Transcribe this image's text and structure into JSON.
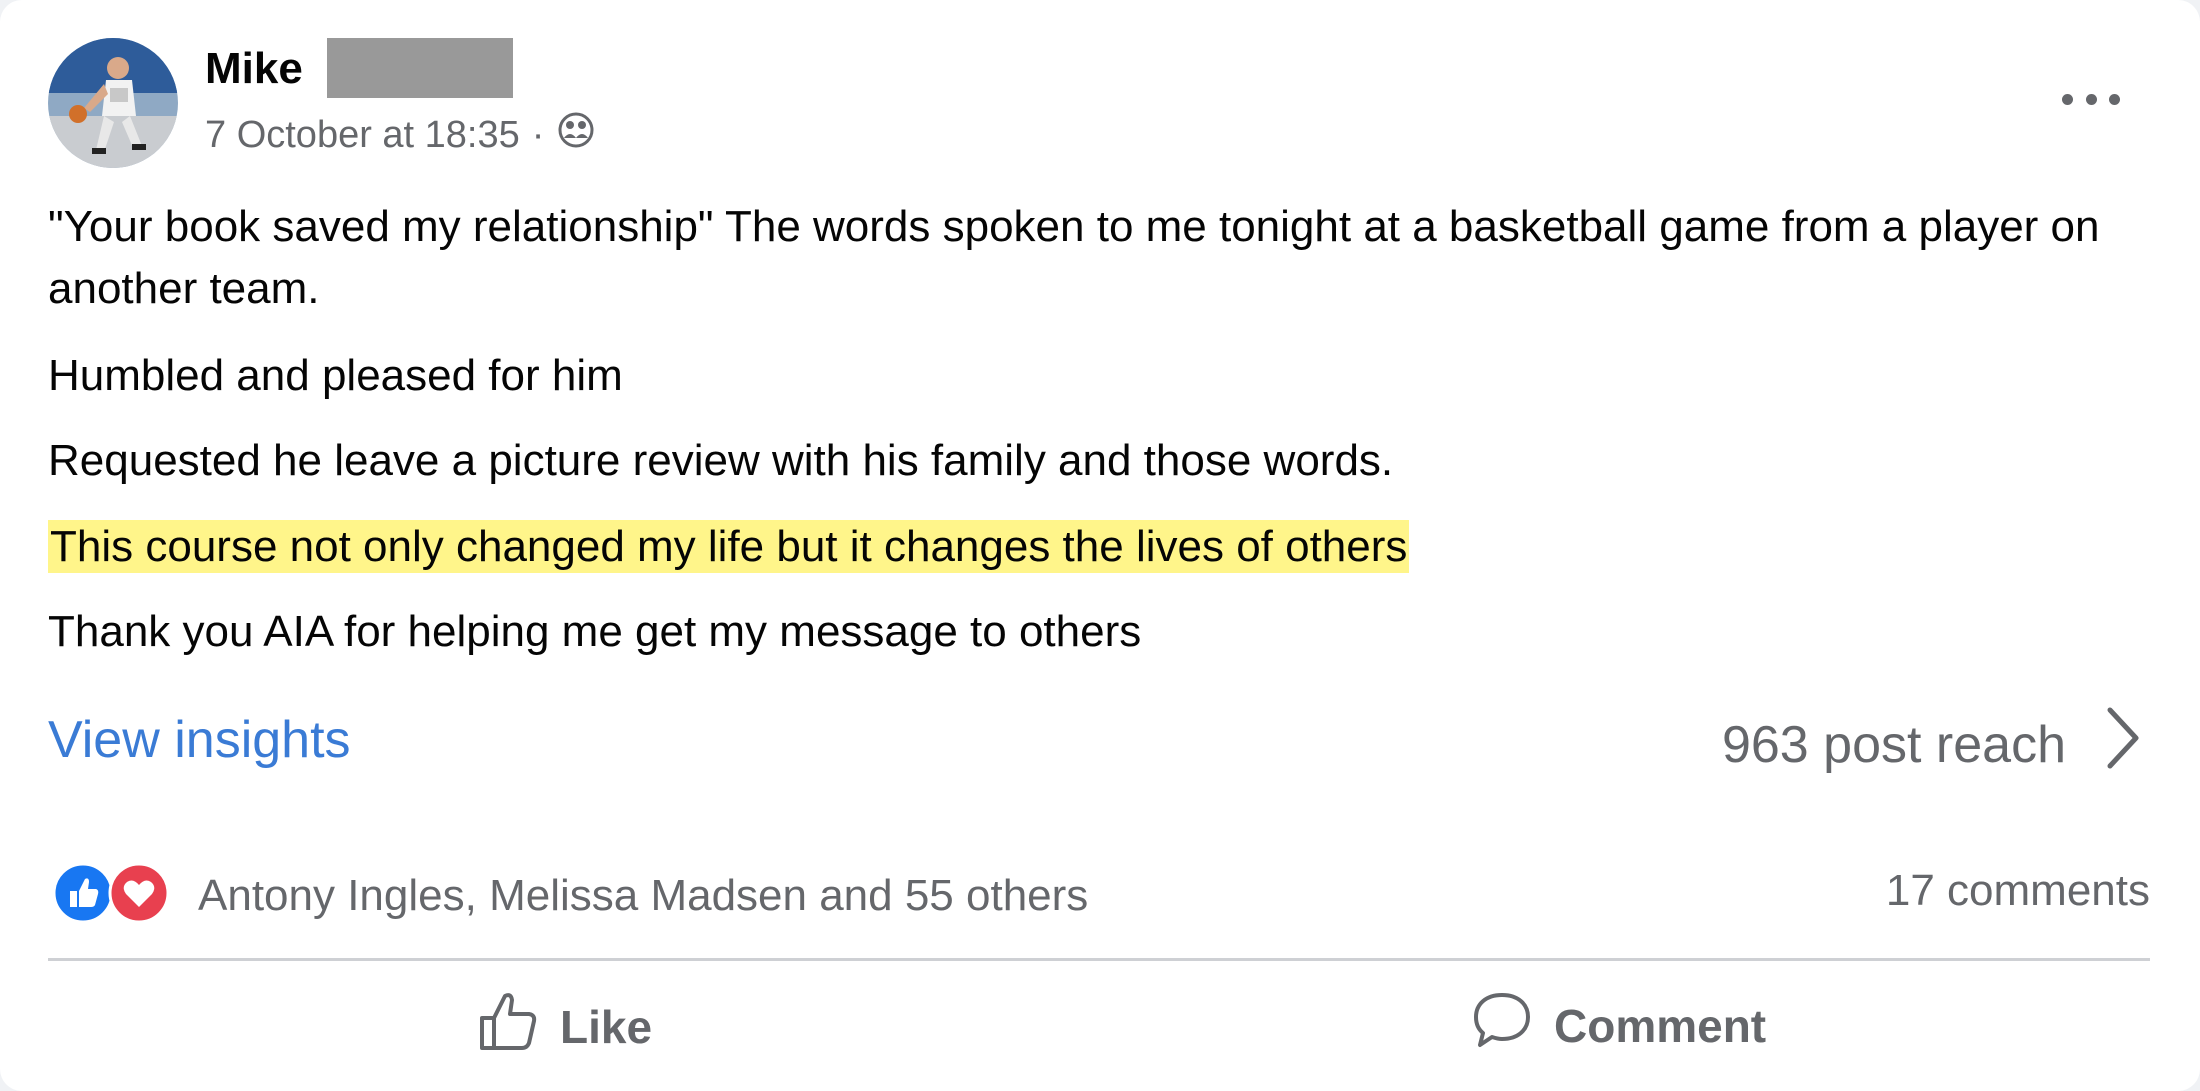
{
  "post": {
    "author": "Mike",
    "timestamp": "7 October at 18:35",
    "separator": "·",
    "privacy_icon": "friends-icon",
    "more_icon": "more-options-icon",
    "paragraphs": [
      "\"Your book saved my relationship\" The words spoken to me tonight at a basketball game from a player on another team.",
      "Humbled and pleased for him",
      "Requested he leave a picture review with his family and those words.",
      "This course not only changed my life but it changes the lives of others",
      "Thank you AIA for helping me get my message to others"
    ]
  },
  "insights": {
    "link_label": "View insights",
    "reach": "963 post reach",
    "chevron_icon": "chevron-right-icon"
  },
  "engagement": {
    "reaction_icons": [
      "like-reaction-icon",
      "love-reaction-icon"
    ],
    "reactors": "Antony Ingles, Melissa Madsen and 55 others",
    "comments": "17 comments"
  },
  "actions": {
    "like_label": "Like",
    "comment_label": "Comment"
  },
  "colors": {
    "link": "#3a7bd5",
    "highlight": "#fff58a",
    "like_blue": "#1877f2",
    "love_red": "#e8404f",
    "secondary_text": "#65676b"
  }
}
